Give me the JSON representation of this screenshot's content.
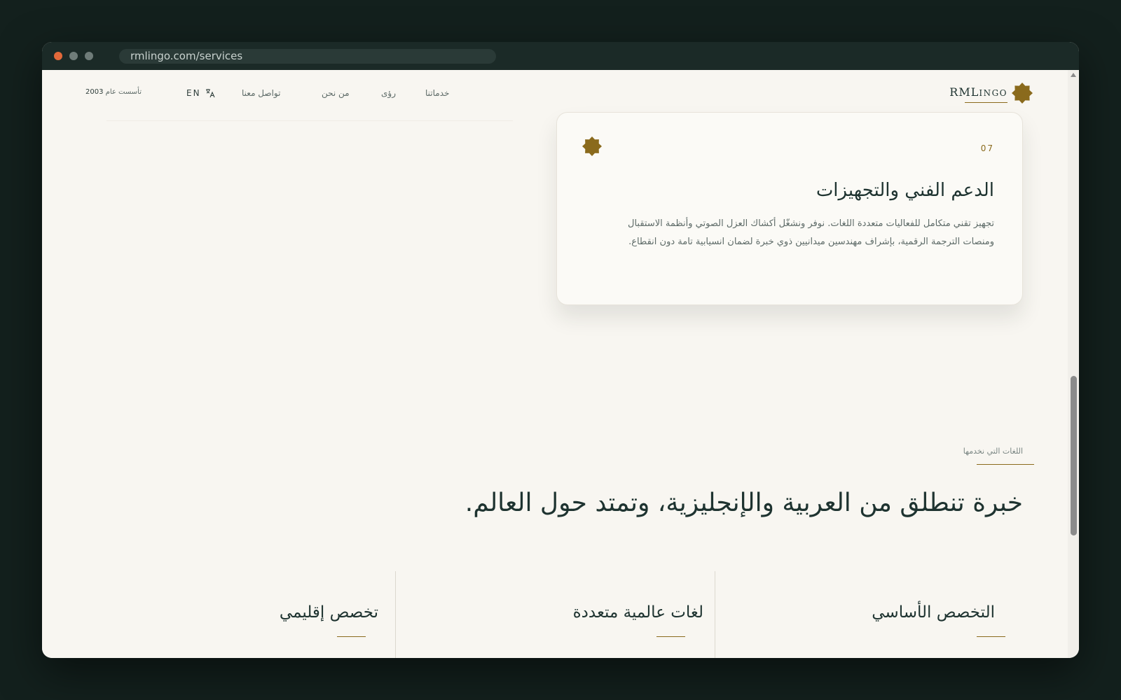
{
  "browser": {
    "url": "rmlingo.com/services"
  },
  "nav": {
    "brand": {
      "prefix": "RML",
      "suffix": "INGO"
    },
    "links": [
      "خدماتنا",
      "رؤى",
      "من نحن",
      "تواصل معنا"
    ],
    "lang_label": "EN",
    "founded_label": "تأسست عام",
    "founded_year": "2003"
  },
  "service_card": {
    "number": "07",
    "title": "الدعم الفني والتجهيزات",
    "description": "تجهيز تقني متكامل للفعاليات متعددة اللغات. نوفر ونشغّل أكشاك العزل الصوتي وأنظمة الاستقبال ومنصات الترجمة الرقمية، بإشراف مهندسين ميدانيين ذوي خبرة لضمان انسيابية تامة دون انقطاع."
  },
  "languages_section": {
    "eyebrow": "اللغات التي نخدمها",
    "headline": "خبرة تنطلق من العربية والإنجليزية، وتمتد حول العالم.",
    "columns": [
      {
        "title": "التخصص الأساسي"
      },
      {
        "title": "لغات عالمية متعددة"
      },
      {
        "title": "تخصص إقليمي"
      }
    ]
  },
  "colors": {
    "accent_gold": "#8a6a1c",
    "ink": "#1e3330",
    "page_bg": "#f8f6f1",
    "outer_bg": "#13201d"
  },
  "icons": {
    "brand": "eight-point-star-icon",
    "card": "eight-point-star-icon",
    "lang": "translate-icon"
  }
}
